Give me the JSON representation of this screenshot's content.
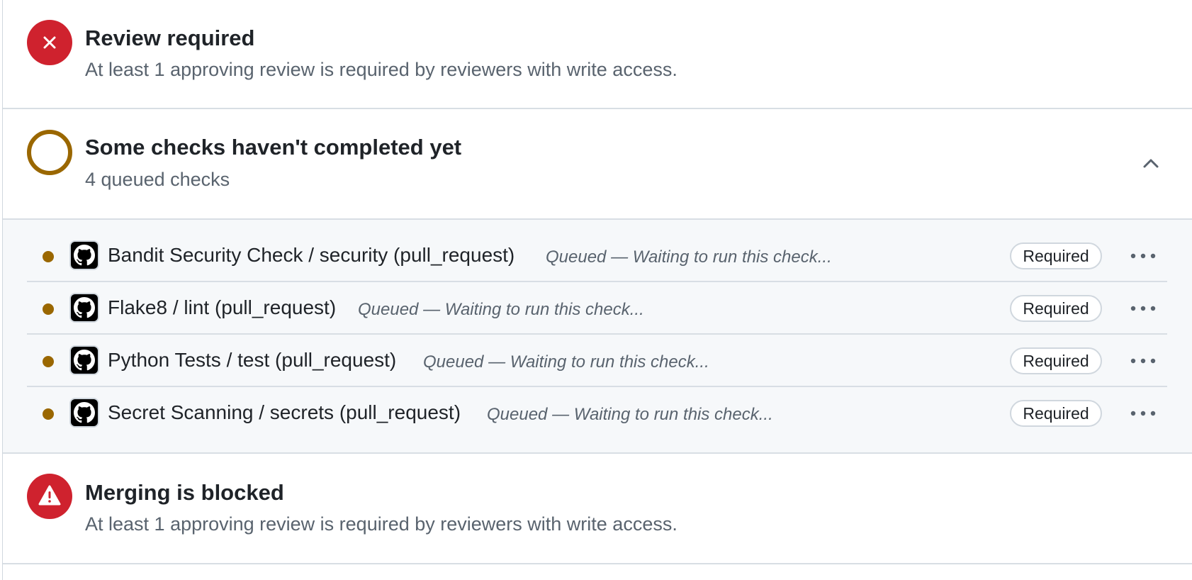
{
  "review": {
    "title": "Review required",
    "description": "At least 1 approving review is required by reviewers with write access."
  },
  "checks": {
    "title": "Some checks haven't completed yet",
    "summary": "4 queued checks",
    "items": [
      {
        "name": "Bandit Security Check / security (pull_request)",
        "status": "Queued — Waiting to run this check...",
        "badge": "Required"
      },
      {
        "name": "Flake8 / lint (pull_request)",
        "status": "Queued — Waiting to run this check...",
        "badge": "Required"
      },
      {
        "name": "Python Tests / test (pull_request)",
        "status": "Queued — Waiting to run this check...",
        "badge": "Required"
      },
      {
        "name": "Secret Scanning / secrets (pull_request)",
        "status": "Queued — Waiting to run this check...",
        "badge": "Required"
      }
    ]
  },
  "merge": {
    "title": "Merging is blocked",
    "description": "At least 1 approving review is required by reviewers with write access."
  },
  "icons": {
    "review": "x-circle-icon",
    "checks": "pending-circle-icon",
    "collapse": "chevron-up-icon",
    "check_status": "queued-dot-icon",
    "app": "github-icon",
    "more": "kebab-horizontal-icon",
    "merge": "alert-icon"
  },
  "colors": {
    "danger": "#cf222e",
    "attention": "#9a6700",
    "muted_text": "#59636e",
    "border": "#d8dee4",
    "list_background": "#f6f8fa"
  }
}
